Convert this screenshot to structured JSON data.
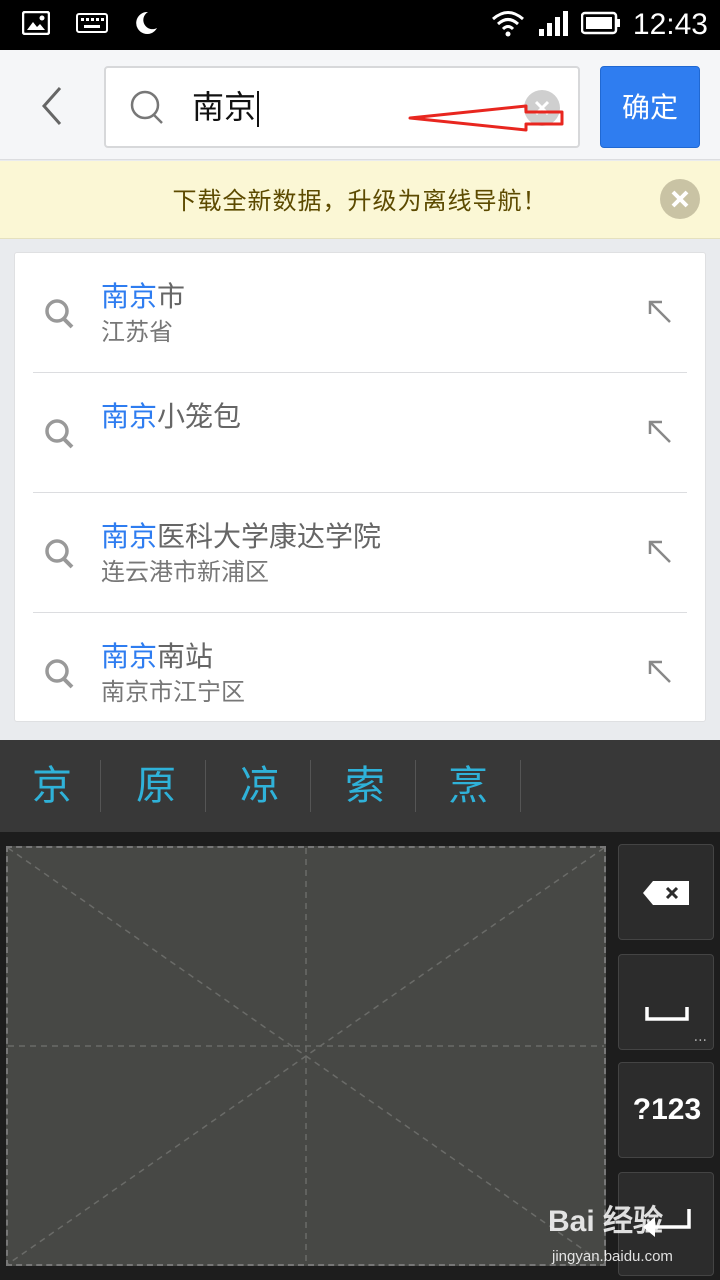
{
  "status_bar": {
    "time": "12:43",
    "icons": [
      "image-notification-icon",
      "keyboard-notification-icon",
      "moon-icon",
      "wifi-icon",
      "signal-icon",
      "battery-icon"
    ]
  },
  "search": {
    "back_icon": "chevron-left-icon",
    "search_icon": "search-icon",
    "value": "南京",
    "clear_icon": "clear-icon",
    "confirm_label": "确定"
  },
  "banner": {
    "text": "下载全新数据，升级为离线导航！",
    "close_icon": "close-icon"
  },
  "suggestions": [
    {
      "highlight": "南京",
      "rest": "市",
      "sub": "江苏省"
    },
    {
      "highlight": "南京",
      "rest": "小笼包",
      "sub": ""
    },
    {
      "highlight": "南京",
      "rest": "医科大学康达学院",
      "sub": "连云港市新浦区"
    },
    {
      "highlight": "南京",
      "rest": "南站",
      "sub": "南京市江宁区"
    }
  ],
  "candidates": [
    "京",
    "原",
    "凉",
    "索",
    "烹"
  ],
  "keyboard": {
    "keys": [
      {
        "name": "backspace-key",
        "label": ""
      },
      {
        "name": "space-key",
        "label": ""
      },
      {
        "name": "symbols-key",
        "label": "?123"
      },
      {
        "name": "enter-key",
        "label": ""
      }
    ],
    "space_dots": "..."
  },
  "watermark": {
    "brand": "Bai 经验",
    "url": "jingyan.baidu.com"
  },
  "colors": {
    "accent": "#2f7df0",
    "candidate": "#2fb2d9",
    "banner_bg": "#fbf7d5",
    "annotation_red": "#e8261f"
  }
}
